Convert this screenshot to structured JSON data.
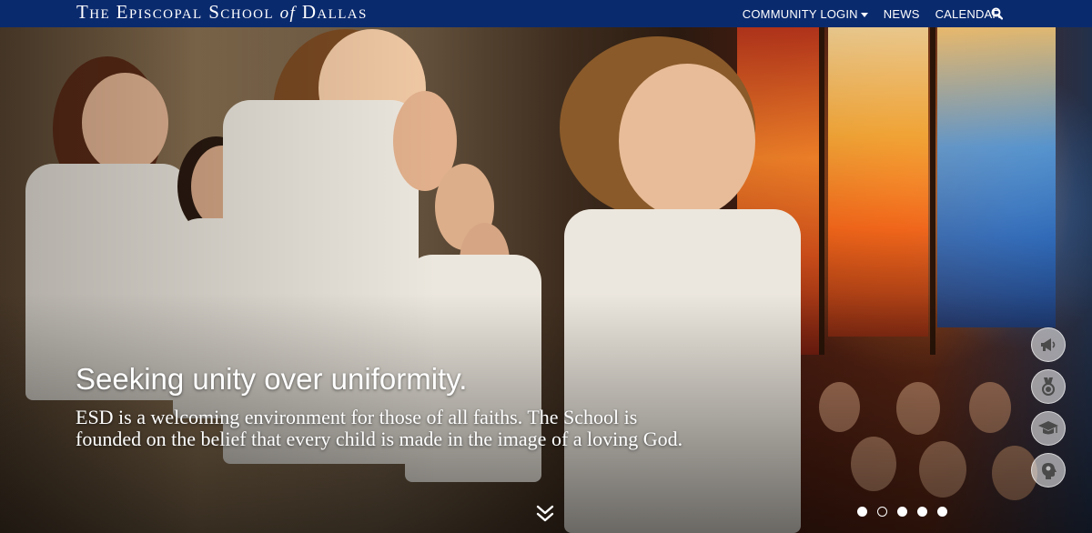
{
  "header": {
    "brand_pre": "The Episcopal School ",
    "brand_of": "of",
    "brand_post": " Dallas",
    "nav": {
      "community_login": "COMMUNITY LOGIN",
      "news": "NEWS",
      "calendar": "CALENDAR"
    },
    "background_color": "#0a2a6e"
  },
  "hero": {
    "headline": "Seeking unity over uniformity.",
    "body": "ESD is a welcoming environment for those of all faiths. The School is founded on the belief that every child is made in the image of a loving God."
  },
  "side_icons": [
    "megaphone-icon",
    "medal-icon",
    "graduation-cap-icon",
    "head-profile-icon"
  ],
  "slider": {
    "total": 5,
    "active_index": 1
  }
}
